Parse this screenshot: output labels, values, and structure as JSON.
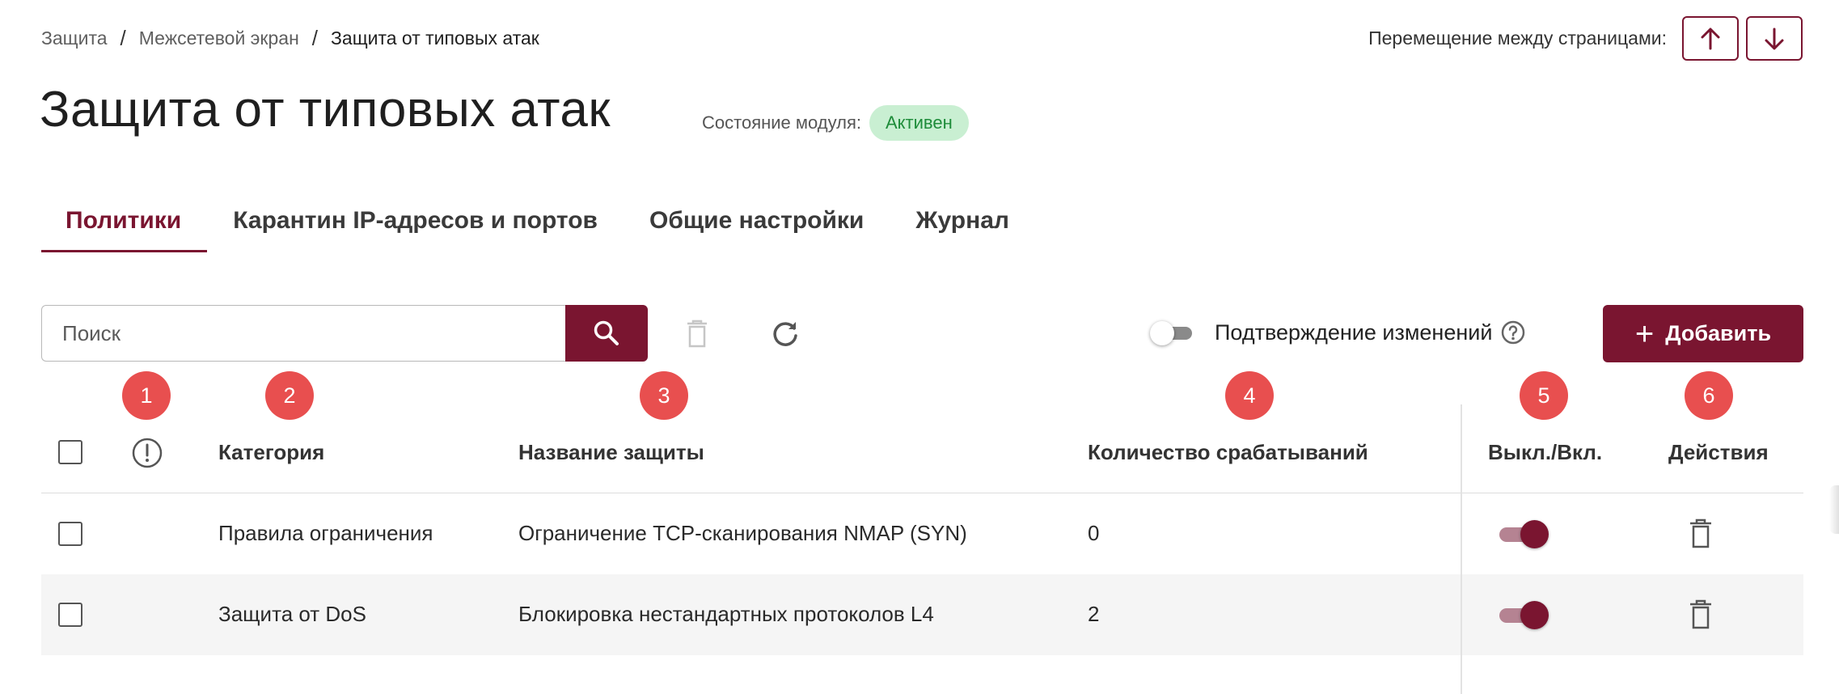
{
  "breadcrumb": {
    "items": [
      "Защита",
      "Межсетевой экран",
      "Защита от типовых атак"
    ],
    "separator": "/"
  },
  "page_nav": {
    "label": "Перемещение между страницами:",
    "up_icon": "arrow-up-icon",
    "down_icon": "arrow-down-icon"
  },
  "page": {
    "title": "Защита от типовых атак",
    "module_state_label": "Состояние модуля:",
    "module_state_value": "Активен"
  },
  "tabs": [
    {
      "label": "Политики",
      "active": true
    },
    {
      "label": "Карантин IP-адресов и портов",
      "active": false
    },
    {
      "label": "Общие настройки",
      "active": false
    },
    {
      "label": "Журнал",
      "active": false
    }
  ],
  "toolbar": {
    "search_placeholder": "Поиск",
    "search_icon": "search-icon",
    "delete_icon": "trash-icon",
    "refresh_icon": "refresh-icon",
    "confirm_changes_label": "Подтверждение изменений",
    "confirm_changes_enabled": false,
    "help_icon": "help-circle-icon",
    "add_label": "Добавить"
  },
  "markers": [
    "1",
    "2",
    "3",
    "4",
    "5",
    "6"
  ],
  "table": {
    "headers": {
      "alert_icon": "alert-circle-icon",
      "category": "Категория",
      "name": "Название защиты",
      "count": "Количество срабатываний",
      "toggle": "Выкл./Вкл.",
      "actions": "Действия"
    },
    "rows": [
      {
        "category": "Правила ограничения",
        "name": "Ограничение TCP-сканирования NMAP (SYN)",
        "count": "0",
        "enabled": true
      },
      {
        "category": "Защита от DoS",
        "name": "Блокировка нестандартных протоколов L4",
        "count": "2",
        "enabled": true
      }
    ]
  },
  "colors": {
    "accent": "#7a1530",
    "marker": "#e84f4f",
    "status_bg": "#c9efd2",
    "status_text": "#1e8c3a"
  }
}
